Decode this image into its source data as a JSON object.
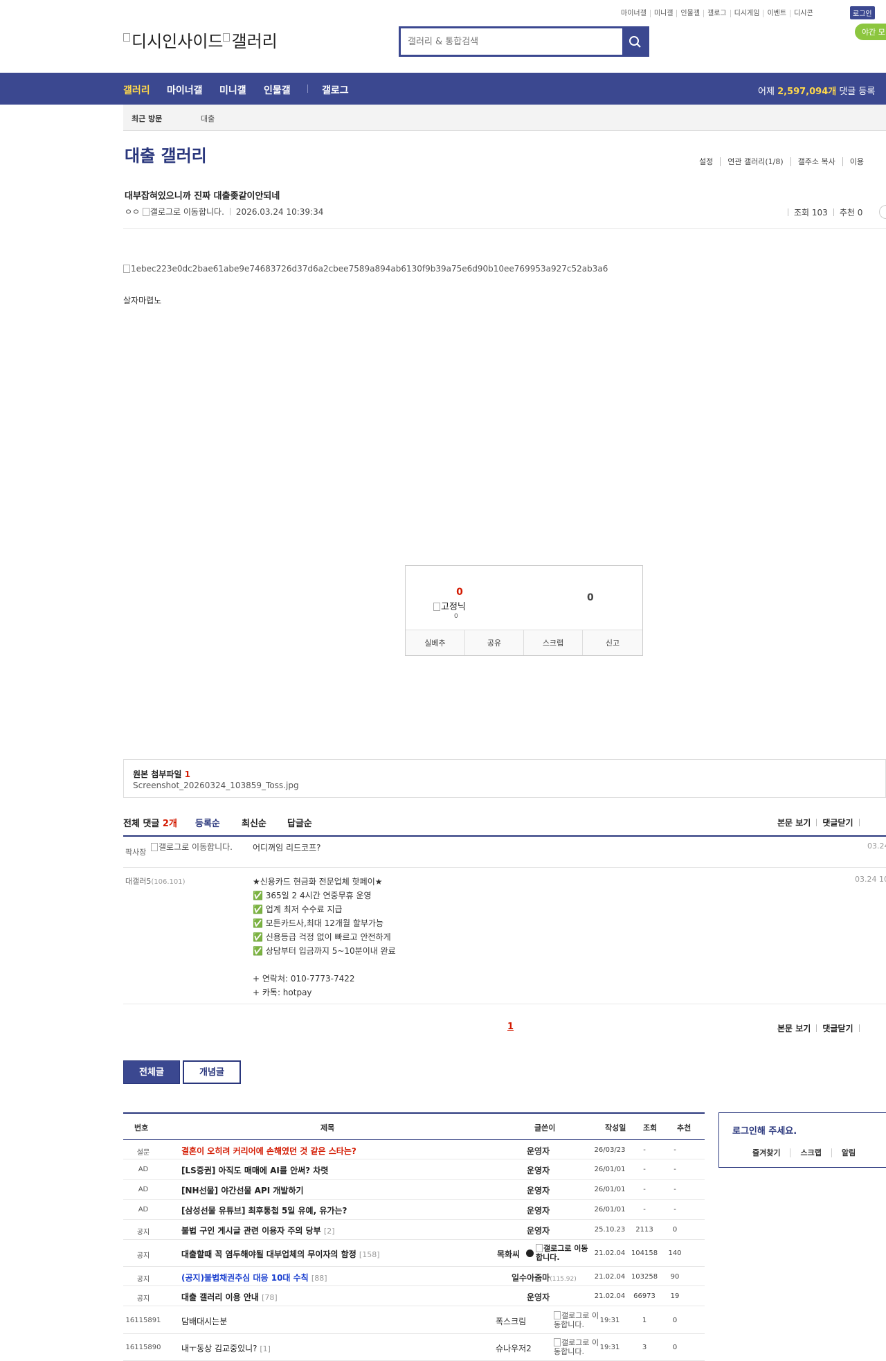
{
  "header": {
    "top_links": [
      "마이너갤",
      "미니갤",
      "인물갤",
      "갤로그",
      "디시게임",
      "이벤트",
      "디시콘"
    ],
    "login": "로그인",
    "night_mode": "야간 모",
    "logo_text": "디시인사이드",
    "logo_text2": "갤러리",
    "search_placeholder": "갤러리 & 통합검색"
  },
  "nav": {
    "items": [
      "갤러리",
      "마이너갤",
      "미니갤",
      "인물갤",
      "갤로그"
    ],
    "stat_prefix": "어제 ",
    "stat_value": "2,597,094개",
    "stat_suffix": " 댓글 등록"
  },
  "subnav": {
    "recent": "최근 방문",
    "gallery": "대출"
  },
  "gallery": {
    "title": "대출 갤러리",
    "menu": [
      "설정",
      "연관 갤러리(1/8)",
      "갤주소 복사",
      "이용"
    ]
  },
  "post": {
    "title": "대부잡혀있으니까 진짜 대출좆같이안되네",
    "author": "ㅇㅇ",
    "gallog_alt": "갤로그로 이동합니다.",
    "date": "2026.03.24 10:39:34",
    "views": "조회 103",
    "reco": "추천 0",
    "image_alt": "1ebec223e0dc2bae61abe9e74683726d37d6a2cbee7589a894ab6130f9b39a75e6d90b10ee769953a927c52ab3a6",
    "body": "살자마렵노"
  },
  "reco_box": {
    "up": "0",
    "fixed_label": "고정닉",
    "fixed_count": "0",
    "down": "0",
    "actions": [
      "실베추",
      "공유",
      "스크랩",
      "신고"
    ]
  },
  "attachment": {
    "label": "원본 첨부파일",
    "count": "1",
    "file": "Screenshot_20260324_103859_Toss.jpg"
  },
  "comments": {
    "total_label": "전체 댓글",
    "total_count": "2개",
    "sort": [
      "등록순",
      "최신순",
      "답글순"
    ],
    "view_body": "본문 보기",
    "close": "댓글닫기",
    "items": [
      {
        "nick": "팍사장",
        "gallog_alt": "갤로그로 이동합니다.",
        "text": "어디꺼임 리드코프?",
        "date": "03.24"
      },
      {
        "nick": "대갤러5",
        "ip": "(106.101)",
        "text": "★신용카드 현금화 전문업체 핫페이★\n✅ 365일 2 4시간 연중무휴 운영\n✅ 업계 최저 수수료 지급\n✅ 모든카드사,최대 12개월 할부가능\n✅ 신용등급 걱정 없이 빠르고 안전하게\n✅ 상담부터 입금까지 5~10분이내 완료\n\n+ 연락처: 010-7773-7422\n+ 카톡: hotpay",
        "date": "03.24 10"
      }
    ],
    "page": "1"
  },
  "list_buttons": {
    "all": "전체글",
    "concept": "개념글"
  },
  "list": {
    "headers": [
      "번호",
      "제목",
      "글쓴이",
      "작성일",
      "조회",
      "추천"
    ],
    "rows": [
      {
        "num": "설문",
        "title": "결혼이 오히려 커리어에 손해였던 것 같은 스타는?",
        "replies": "",
        "writer": "운영자",
        "date": "26/03/23",
        "views": "-",
        "reco": "-",
        "style": "red"
      },
      {
        "num": "AD",
        "title": "[LS증권] 아직도 매매에 AI를 안써? 차렷",
        "replies": "",
        "writer": "운영자",
        "date": "26/01/01",
        "views": "-",
        "reco": "-",
        "style": "bold"
      },
      {
        "num": "AD",
        "title": "[NH선물] 야간선물 API 개발하기",
        "replies": "",
        "writer": "운영자",
        "date": "26/01/01",
        "views": "-",
        "reco": "-",
        "style": "bold"
      },
      {
        "num": "AD",
        "title": "[삼성선물 유튜브] 최후통첩 5일 유예, 유가는?",
        "replies": "",
        "writer": "운영자",
        "date": "26/01/01",
        "views": "-",
        "reco": "-",
        "style": "bold"
      },
      {
        "num": "공지",
        "title": "불법 구인 게시글 관련 이용자 주의 당부",
        "replies": "[2]",
        "writer": "운영자",
        "date": "25.10.23",
        "views": "2113",
        "reco": "0",
        "style": "bold"
      },
      {
        "num": "공지",
        "title": "대출할때 꼭 염두해야될 대부업체의 무이자의 함정",
        "replies": "[158]",
        "writer": "목화씨",
        "writer_alt": "갤로그로 이동합니다.",
        "date": "21.02.04",
        "views": "104158",
        "reco": "140",
        "style": "bold"
      },
      {
        "num": "공지",
        "title": "(공지)불법채권추심 대응 10대 수칙",
        "replies": "[88]",
        "writer": "일수아줌마",
        "writer_ip": "(115.92)",
        "date": "21.02.04",
        "views": "103258",
        "reco": "90",
        "style": "blue"
      },
      {
        "num": "공지",
        "title": "대출 갤러리 이용 안내",
        "replies": "[78]",
        "writer": "운영자",
        "date": "21.02.04",
        "views": "66973",
        "reco": "19",
        "style": "bold"
      },
      {
        "num": "16115891",
        "title": "담배대시는분",
        "replies": "",
        "writer": "폭스크림",
        "writer_alt": "갤로그로 이동합니다.",
        "date": "19:31",
        "views": "1",
        "reco": "0",
        "style": "normal"
      },
      {
        "num": "16115890",
        "title": "내ㅜ동상 김교중있니?",
        "replies": "[1]",
        "writer": "슈나우저2",
        "writer_alt": "갤로그로 이동합니다.",
        "date": "19:31",
        "views": "3",
        "reco": "0",
        "style": "normal"
      }
    ]
  },
  "login_panel": {
    "title": "로그인해 주세요.",
    "links": [
      "즐겨찾기",
      "스크랩",
      "알림"
    ]
  },
  "colors": {
    "brand": "#3b4890",
    "accent_red": "#d31900",
    "highlight_yellow": "#ffd84a",
    "night_green": "#8cc63f"
  }
}
